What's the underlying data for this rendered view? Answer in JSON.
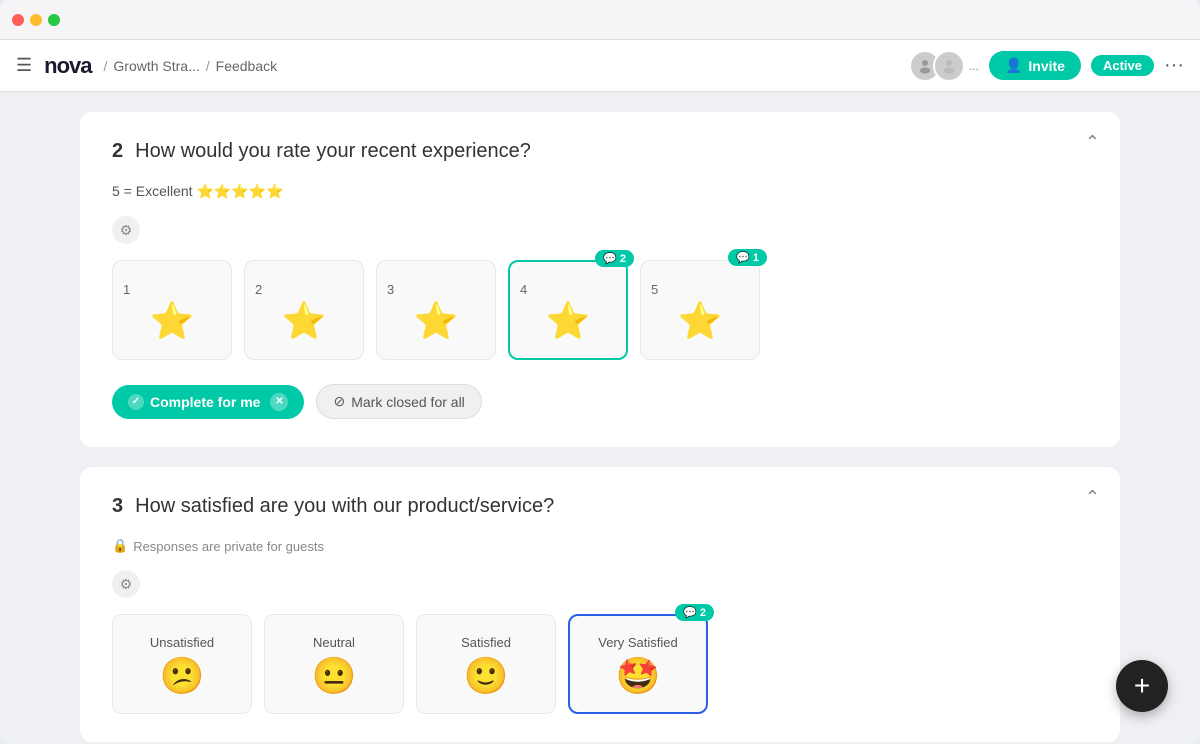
{
  "window": {
    "title": "Nova"
  },
  "navbar": {
    "logo": "nova",
    "breadcrumb": {
      "separator": "/",
      "path1": "Growth Stra...",
      "path2": "Feedback"
    },
    "invite_label": "Invite",
    "active_label": "Active",
    "more_options": "···"
  },
  "question2": {
    "number": "2",
    "text": "How would you rate your recent experience?",
    "rating_label": "5 = Excellent ⭐⭐⭐⭐⭐",
    "stars": [
      {
        "id": 1,
        "label": "1",
        "selected": false,
        "badge": null
      },
      {
        "id": 2,
        "label": "2",
        "selected": false,
        "badge": null
      },
      {
        "id": 3,
        "label": "3",
        "selected": false,
        "badge": null
      },
      {
        "id": 4,
        "label": "4",
        "selected": true,
        "badge": "2"
      },
      {
        "id": 5,
        "label": "5",
        "selected": false,
        "badge": "1"
      }
    ],
    "complete_btn": "Complete for me",
    "mark_closed_btn": "Mark closed for all"
  },
  "question3": {
    "number": "3",
    "text": "How satisfied are you with our product/service?",
    "private_note": "Responses are private for guests",
    "options": [
      {
        "id": "unsatisfied",
        "label": "Unsatisfied",
        "emoji": "😕",
        "selected": false,
        "badge": null
      },
      {
        "id": "neutral",
        "label": "Neutral",
        "emoji": "😐",
        "selected": false,
        "badge": null
      },
      {
        "id": "satisfied",
        "label": "Satisfied",
        "emoji": "🙂",
        "selected": false,
        "badge": null
      },
      {
        "id": "very-satisfied",
        "label": "Very Satisfied",
        "emoji": "🤩",
        "selected": true,
        "badge": "2"
      }
    ]
  },
  "fab": {
    "label": "+"
  }
}
